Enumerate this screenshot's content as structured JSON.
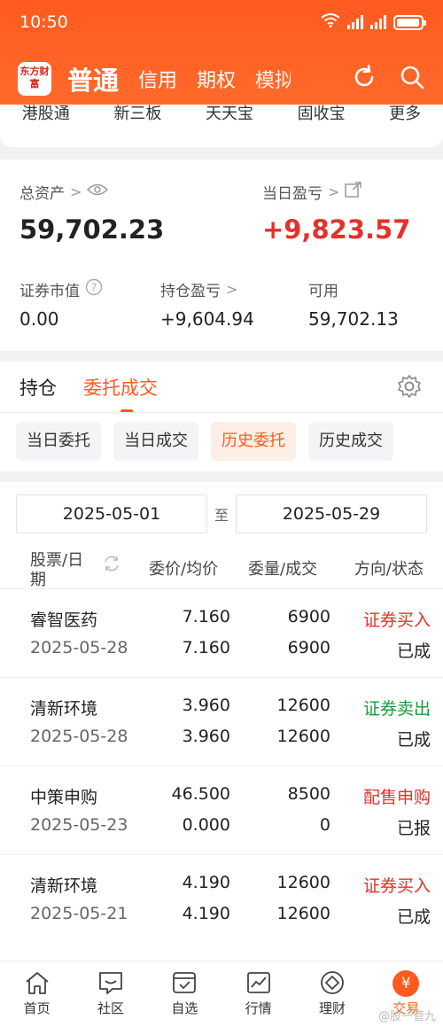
{
  "status": {
    "time": "10:50"
  },
  "nav": {
    "logo": "东方财富",
    "tabs": [
      "普通",
      "信用",
      "期权",
      "模拟"
    ]
  },
  "quick_menu": [
    "港股通",
    "新三板",
    "天天宝",
    "固收宝",
    "更多"
  ],
  "assets": {
    "total_label": "总资产",
    "total_value": "59,702.23",
    "day_pl_label": "当日盈亏",
    "day_pl_value": "+9,823.57",
    "market_value_label": "证券市值",
    "market_value": "0.00",
    "position_pl_label": "持仓盈亏",
    "position_pl": "+9,604.94",
    "available_label": "可用",
    "available": "59,702.13"
  },
  "tabs": {
    "main": [
      "持仓",
      "委托成交"
    ],
    "sub": [
      "当日委托",
      "当日成交",
      "历史委托",
      "历史成交"
    ]
  },
  "filter": {
    "start": "2025-05-01",
    "to": "至",
    "end": "2025-05-29"
  },
  "columns": {
    "stock": "股票/日期",
    "price": "委价/均价",
    "qty": "委量/成交",
    "dir": "方向/状态"
  },
  "orders": [
    {
      "name": "睿智医药",
      "date": "2025-05-28",
      "order_price": "7.160",
      "avg_price": "7.160",
      "order_qty": "6900",
      "filled": "6900",
      "direction": "证券买入",
      "status": "已成",
      "color": "#e5312a"
    },
    {
      "name": "清新环境",
      "date": "2025-05-28",
      "order_price": "3.960",
      "avg_price": "3.960",
      "order_qty": "12600",
      "filled": "12600",
      "direction": "证券卖出",
      "status": "已成",
      "color": "#1a9a3a"
    },
    {
      "name": "中策申购",
      "date": "2025-05-23",
      "order_price": "46.500",
      "avg_price": "0.000",
      "order_qty": "8500",
      "filled": "0",
      "direction": "配售申购",
      "status": "已报",
      "color": "#e5312a"
    },
    {
      "name": "清新环境",
      "date": "2025-05-21",
      "order_price": "4.190",
      "avg_price": "4.190",
      "order_qty": "12600",
      "filled": "12600",
      "direction": "证券买入",
      "status": "已成",
      "color": "#e5312a"
    }
  ],
  "bottom_nav": [
    "首页",
    "社区",
    "自选",
    "行情",
    "理财",
    "交易"
  ],
  "watermark": "@股一管九"
}
